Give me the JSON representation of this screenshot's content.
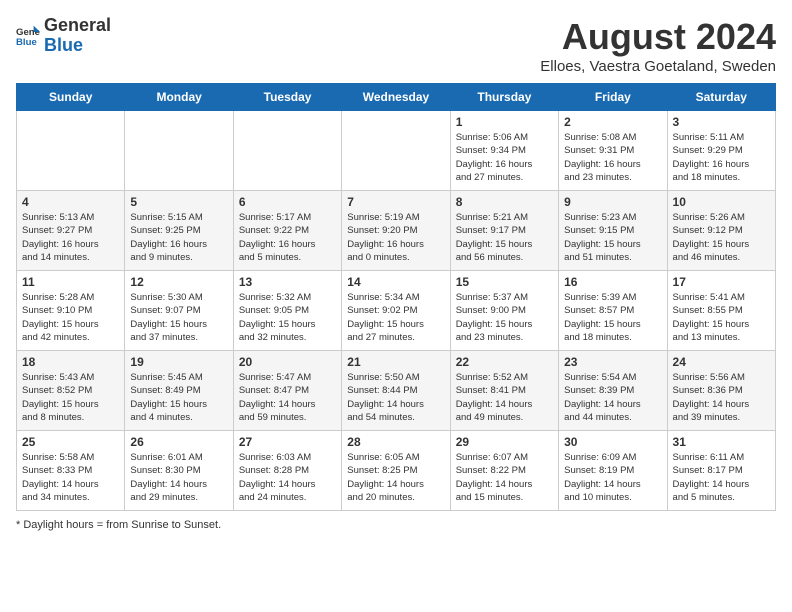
{
  "header": {
    "logo_general": "General",
    "logo_blue": "Blue",
    "title": "August 2024",
    "subtitle": "Elloes, Vaestra Goetaland, Sweden"
  },
  "days_of_week": [
    "Sunday",
    "Monday",
    "Tuesday",
    "Wednesday",
    "Thursday",
    "Friday",
    "Saturday"
  ],
  "footer": {
    "note": "Daylight hours"
  },
  "weeks": [
    {
      "days": [
        {
          "num": "",
          "info": ""
        },
        {
          "num": "",
          "info": ""
        },
        {
          "num": "",
          "info": ""
        },
        {
          "num": "",
          "info": ""
        },
        {
          "num": "1",
          "info": "Sunrise: 5:06 AM\nSunset: 9:34 PM\nDaylight: 16 hours\nand 27 minutes."
        },
        {
          "num": "2",
          "info": "Sunrise: 5:08 AM\nSunset: 9:31 PM\nDaylight: 16 hours\nand 23 minutes."
        },
        {
          "num": "3",
          "info": "Sunrise: 5:11 AM\nSunset: 9:29 PM\nDaylight: 16 hours\nand 18 minutes."
        }
      ]
    },
    {
      "days": [
        {
          "num": "4",
          "info": "Sunrise: 5:13 AM\nSunset: 9:27 PM\nDaylight: 16 hours\nand 14 minutes."
        },
        {
          "num": "5",
          "info": "Sunrise: 5:15 AM\nSunset: 9:25 PM\nDaylight: 16 hours\nand 9 minutes."
        },
        {
          "num": "6",
          "info": "Sunrise: 5:17 AM\nSunset: 9:22 PM\nDaylight: 16 hours\nand 5 minutes."
        },
        {
          "num": "7",
          "info": "Sunrise: 5:19 AM\nSunset: 9:20 PM\nDaylight: 16 hours\nand 0 minutes."
        },
        {
          "num": "8",
          "info": "Sunrise: 5:21 AM\nSunset: 9:17 PM\nDaylight: 15 hours\nand 56 minutes."
        },
        {
          "num": "9",
          "info": "Sunrise: 5:23 AM\nSunset: 9:15 PM\nDaylight: 15 hours\nand 51 minutes."
        },
        {
          "num": "10",
          "info": "Sunrise: 5:26 AM\nSunset: 9:12 PM\nDaylight: 15 hours\nand 46 minutes."
        }
      ]
    },
    {
      "days": [
        {
          "num": "11",
          "info": "Sunrise: 5:28 AM\nSunset: 9:10 PM\nDaylight: 15 hours\nand 42 minutes."
        },
        {
          "num": "12",
          "info": "Sunrise: 5:30 AM\nSunset: 9:07 PM\nDaylight: 15 hours\nand 37 minutes."
        },
        {
          "num": "13",
          "info": "Sunrise: 5:32 AM\nSunset: 9:05 PM\nDaylight: 15 hours\nand 32 minutes."
        },
        {
          "num": "14",
          "info": "Sunrise: 5:34 AM\nSunset: 9:02 PM\nDaylight: 15 hours\nand 27 minutes."
        },
        {
          "num": "15",
          "info": "Sunrise: 5:37 AM\nSunset: 9:00 PM\nDaylight: 15 hours\nand 23 minutes."
        },
        {
          "num": "16",
          "info": "Sunrise: 5:39 AM\nSunset: 8:57 PM\nDaylight: 15 hours\nand 18 minutes."
        },
        {
          "num": "17",
          "info": "Sunrise: 5:41 AM\nSunset: 8:55 PM\nDaylight: 15 hours\nand 13 minutes."
        }
      ]
    },
    {
      "days": [
        {
          "num": "18",
          "info": "Sunrise: 5:43 AM\nSunset: 8:52 PM\nDaylight: 15 hours\nand 8 minutes."
        },
        {
          "num": "19",
          "info": "Sunrise: 5:45 AM\nSunset: 8:49 PM\nDaylight: 15 hours\nand 4 minutes."
        },
        {
          "num": "20",
          "info": "Sunrise: 5:47 AM\nSunset: 8:47 PM\nDaylight: 14 hours\nand 59 minutes."
        },
        {
          "num": "21",
          "info": "Sunrise: 5:50 AM\nSunset: 8:44 PM\nDaylight: 14 hours\nand 54 minutes."
        },
        {
          "num": "22",
          "info": "Sunrise: 5:52 AM\nSunset: 8:41 PM\nDaylight: 14 hours\nand 49 minutes."
        },
        {
          "num": "23",
          "info": "Sunrise: 5:54 AM\nSunset: 8:39 PM\nDaylight: 14 hours\nand 44 minutes."
        },
        {
          "num": "24",
          "info": "Sunrise: 5:56 AM\nSunset: 8:36 PM\nDaylight: 14 hours\nand 39 minutes."
        }
      ]
    },
    {
      "days": [
        {
          "num": "25",
          "info": "Sunrise: 5:58 AM\nSunset: 8:33 PM\nDaylight: 14 hours\nand 34 minutes."
        },
        {
          "num": "26",
          "info": "Sunrise: 6:01 AM\nSunset: 8:30 PM\nDaylight: 14 hours\nand 29 minutes."
        },
        {
          "num": "27",
          "info": "Sunrise: 6:03 AM\nSunset: 8:28 PM\nDaylight: 14 hours\nand 24 minutes."
        },
        {
          "num": "28",
          "info": "Sunrise: 6:05 AM\nSunset: 8:25 PM\nDaylight: 14 hours\nand 20 minutes."
        },
        {
          "num": "29",
          "info": "Sunrise: 6:07 AM\nSunset: 8:22 PM\nDaylight: 14 hours\nand 15 minutes."
        },
        {
          "num": "30",
          "info": "Sunrise: 6:09 AM\nSunset: 8:19 PM\nDaylight: 14 hours\nand 10 minutes."
        },
        {
          "num": "31",
          "info": "Sunrise: 6:11 AM\nSunset: 8:17 PM\nDaylight: 14 hours\nand 5 minutes."
        }
      ]
    }
  ]
}
